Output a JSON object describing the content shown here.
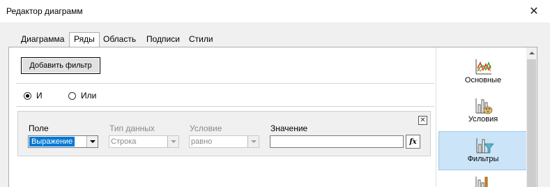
{
  "window": {
    "title": "Редактор диаграмм",
    "close_glyph": "✕"
  },
  "tabs": [
    {
      "label": "Диаграмма",
      "active": false
    },
    {
      "label": "Ряды",
      "active": true
    },
    {
      "label": "Область",
      "active": false
    },
    {
      "label": "Подписи",
      "active": false
    },
    {
      "label": "Стили",
      "active": false
    }
  ],
  "toolbar": {
    "add_filter_label": "Добавить фильтр"
  },
  "logic": {
    "options": [
      {
        "label": "И",
        "checked": true
      },
      {
        "label": "Или",
        "checked": false
      }
    ]
  },
  "filter": {
    "close_glyph": "✕",
    "columns": {
      "field": "Поле",
      "data_type": "Тип данных",
      "condition": "Условие",
      "value": "Значение"
    },
    "field_value": "Выражение",
    "data_type_value": "Строка",
    "condition_value": "равно",
    "value_text": "",
    "fx_label": "fx"
  },
  "sidebar": {
    "items": [
      {
        "label": "Основные",
        "icon": "line-chart-icon",
        "selected": false
      },
      {
        "label": "Условия",
        "icon": "chart-palette-icon",
        "selected": false
      },
      {
        "label": "Фильтры",
        "icon": "chart-filter-icon",
        "selected": true
      },
      {
        "label": "",
        "icon": "chart-sort-icon",
        "selected": false
      }
    ]
  },
  "colors": {
    "accent": "#0078d7",
    "selected_bg": "#cce4f7"
  }
}
